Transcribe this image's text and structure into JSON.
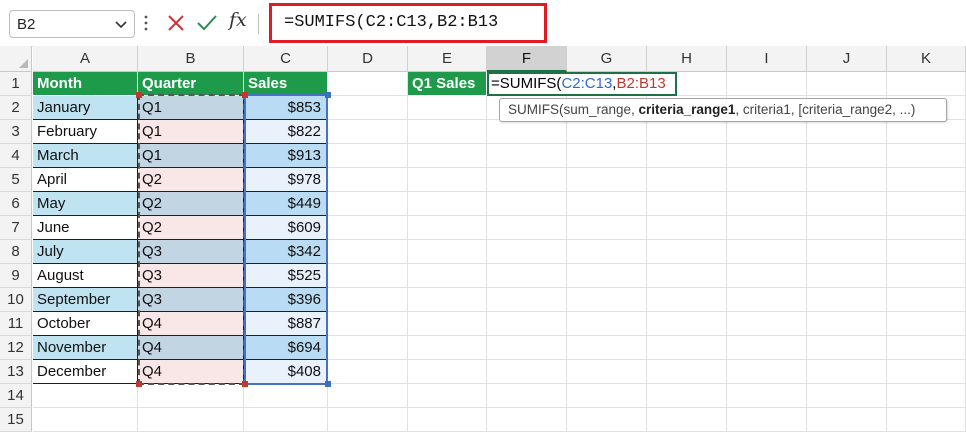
{
  "formula_bar": {
    "name_box": "B2",
    "fx_label": "fx",
    "formula_text": "=SUMIFS(C2:C13,B2:B13"
  },
  "columns": [
    "A",
    "B",
    "C",
    "D",
    "E",
    "F",
    "G",
    "H",
    "I",
    "J",
    "K"
  ],
  "rows": [
    "1",
    "2",
    "3",
    "4",
    "5",
    "6",
    "7",
    "8",
    "9",
    "10",
    "11",
    "12",
    "13",
    "14",
    "15"
  ],
  "table": {
    "headers": [
      "Month",
      "Quarter",
      "Sales"
    ],
    "rows": [
      [
        "January",
        "Q1",
        "$853"
      ],
      [
        "February",
        "Q1",
        "$822"
      ],
      [
        "March",
        "Q1",
        "$913"
      ],
      [
        "April",
        "Q2",
        "$978"
      ],
      [
        "May",
        "Q2",
        "$449"
      ],
      [
        "June",
        "Q2",
        "$609"
      ],
      [
        "July",
        "Q3",
        "$342"
      ],
      [
        "August",
        "Q3",
        "$525"
      ],
      [
        "September",
        "Q3",
        "$396"
      ],
      [
        "October",
        "Q4",
        "$887"
      ],
      [
        "November",
        "Q4",
        "$694"
      ],
      [
        "December",
        "Q4",
        "$408"
      ]
    ]
  },
  "e1_label": "Q1 Sales",
  "edit_cell": {
    "prefix": "=SUMIFS(",
    "ref1": "C2:C13",
    "comma": ",",
    "ref2": "B2:B13"
  },
  "tooltip": {
    "pre": "SUMIFS(sum_range, ",
    "bold": "criteria_range1",
    "post": ", criteria1, [criteria_range2, ...)"
  },
  "colors": {
    "header_green": "#1e9b4a",
    "band_blue": "#bfe3f1",
    "quarter_pink": "#f9e6e6",
    "sales_band_blue": "#b9dbf3",
    "sales_light": "#e9f1fb",
    "selection_green": "#1e7145",
    "formula_highlight": "#e01b24"
  }
}
